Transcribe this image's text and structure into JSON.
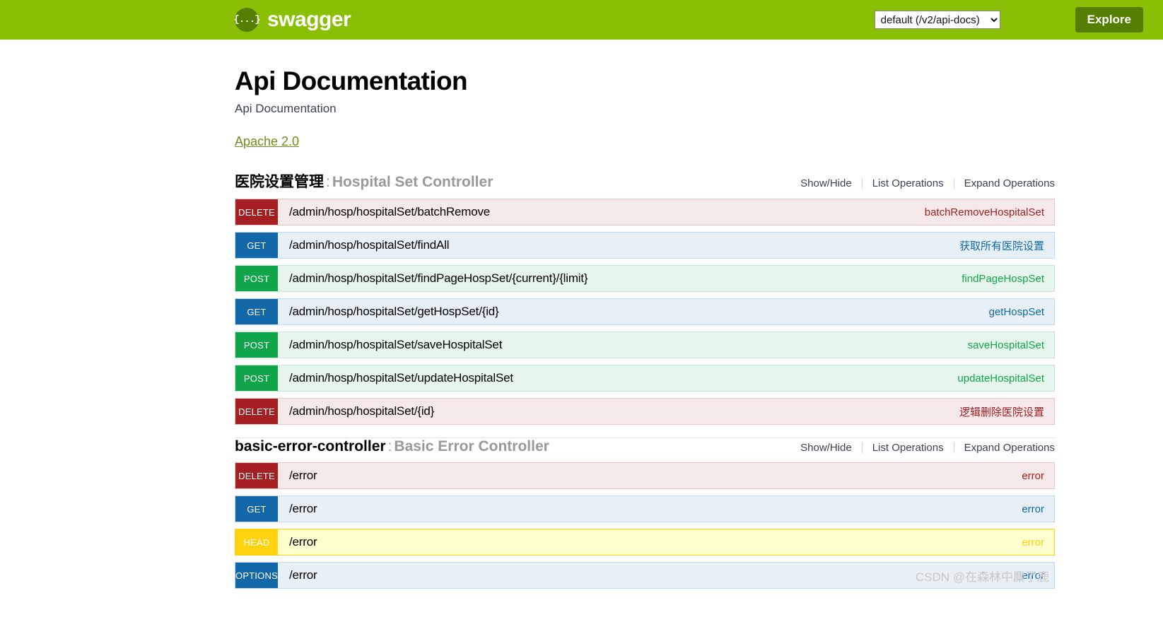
{
  "topbar": {
    "brand_name": "swagger",
    "brand_mark": "{...}",
    "select_value": "default (/v2/api-docs)",
    "explore_label": "Explore"
  },
  "info": {
    "title": "Api Documentation",
    "subtitle": "Api Documentation",
    "license": "Apache 2.0"
  },
  "actions": {
    "show_hide": "Show/Hide",
    "list_operations": "List Operations",
    "expand_operations": "Expand Operations"
  },
  "resources": [
    {
      "name": "医院设置管理",
      "separator": ":",
      "description": "Hospital Set Controller",
      "operations": [
        {
          "method": "DELETE",
          "key": "delete",
          "path": "/admin/hosp/hospitalSet/batchRemove",
          "summary": "batchRemoveHospitalSet"
        },
        {
          "method": "GET",
          "key": "get",
          "path": "/admin/hosp/hospitalSet/findAll",
          "summary": "获取所有医院设置"
        },
        {
          "method": "POST",
          "key": "post",
          "path": "/admin/hosp/hospitalSet/findPageHospSet/{current}/{limit}",
          "summary": "findPageHospSet"
        },
        {
          "method": "GET",
          "key": "get",
          "path": "/admin/hosp/hospitalSet/getHospSet/{id}",
          "summary": "getHospSet"
        },
        {
          "method": "POST",
          "key": "post",
          "path": "/admin/hosp/hospitalSet/saveHospitalSet",
          "summary": "saveHospitalSet"
        },
        {
          "method": "POST",
          "key": "post",
          "path": "/admin/hosp/hospitalSet/updateHospitalSet",
          "summary": "updateHospitalSet"
        },
        {
          "method": "DELETE",
          "key": "delete",
          "path": "/admin/hosp/hospitalSet/{id}",
          "summary": "逻辑删除医院设置"
        }
      ]
    },
    {
      "name": "basic-error-controller",
      "separator": ":",
      "description": "Basic Error Controller",
      "operations": [
        {
          "method": "DELETE",
          "key": "delete",
          "path": "/error",
          "summary": "error"
        },
        {
          "method": "GET",
          "key": "get",
          "path": "/error",
          "summary": "error"
        },
        {
          "method": "HEAD",
          "key": "head",
          "path": "/error",
          "summary": "error"
        },
        {
          "method": "OPTIONS",
          "key": "options",
          "path": "/error",
          "summary": "error"
        }
      ]
    }
  ],
  "watermark": "CSDN @在森林中麋了鹿",
  "colors": {
    "brand_green": "#89bf04",
    "explore_green": "#547f00",
    "get": "#1267a8",
    "post": "#10a54a",
    "delete": "#a41e22",
    "head": "#ffd20f",
    "options": "#1267a8"
  }
}
